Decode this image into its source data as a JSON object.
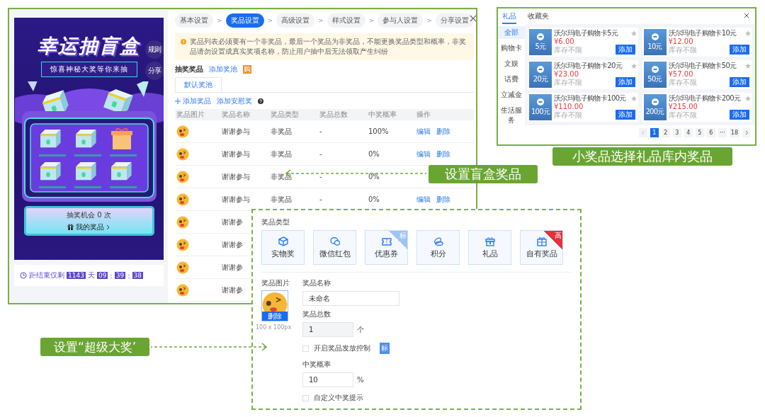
{
  "preview": {
    "title": "幸运抽盲盒",
    "rules_button": "规则",
    "share_button": "分享",
    "subtitle": "惊喜神秘大奖等你来抽",
    "chances": "抽奖机会 0 次",
    "my_prizes": "我的奖品",
    "countdown": [
      {
        "kind": "text",
        "text": "距结束仅剩"
      },
      {
        "kind": "box",
        "text": "1143"
      },
      {
        "kind": "text",
        "text": "天"
      },
      {
        "kind": "box",
        "text": "09"
      },
      {
        "kind": "text",
        "text": ":"
      },
      {
        "kind": "box",
        "text": "39"
      },
      {
        "kind": "text",
        "text": ":"
      },
      {
        "kind": "box",
        "text": "38"
      }
    ]
  },
  "steps": [
    {
      "label": "基本设置",
      "selected": false
    },
    {
      "label": "奖品设置",
      "selected": true
    },
    {
      "label": "高级设置",
      "selected": false
    },
    {
      "label": "样式设置",
      "selected": false
    },
    {
      "label": "参与人设置",
      "selected": false
    },
    {
      "label": "分享设置",
      "selected": false
    }
  ],
  "step_separator": ">",
  "notice": "奖品列表必须要有一个非奖品，最后一个奖品为非奖品，不能更换奖品类型和概率，非奖品请勿设置成真实奖项名称，防止用户抽中后无法领取产生纠纷",
  "pool_label": "抽奖奖品",
  "add_pool_link": "添加奖池",
  "pool_badge": "购",
  "pool_tabs": [
    {
      "label": "默认奖池",
      "selected": true
    }
  ],
  "add_prize_link": "添加奖品",
  "add_consolation_link": "添加安慰奖",
  "table": {
    "columns": [
      "奖品图片",
      "奖品名称",
      "奖品类型",
      "奖品总数",
      "中奖概率",
      "操作"
    ],
    "rows": [
      {
        "name": "谢谢参与",
        "type": "非奖品",
        "total": "-",
        "probability": "100%",
        "actions": [
          "编辑",
          "删除"
        ]
      },
      {
        "name": "谢谢参与",
        "type": "非奖品",
        "total": "-",
        "probability": "0%",
        "actions": [
          "编辑",
          "删除"
        ]
      },
      {
        "name": "谢谢参与",
        "type": "非奖品",
        "total": "-",
        "probability": "0%"
      },
      {
        "name": "谢谢参与",
        "type": "非奖品",
        "total": "-",
        "probability": "0%",
        "actions": [
          "编辑",
          "删除"
        ]
      },
      {
        "name": "谢谢参"
      },
      {
        "name": "谢谢参"
      },
      {
        "name": "谢谢参"
      },
      {
        "name": "谢谢参"
      }
    ]
  },
  "gift_panel": {
    "tabs": [
      {
        "label": "礼品",
        "selected": true
      },
      {
        "label": "收藏夹",
        "selected": false
      }
    ],
    "categories": [
      {
        "label": "全部",
        "selected": true
      },
      {
        "label": "购物卡",
        "selected": false
      },
      {
        "label": "文娱",
        "selected": false
      },
      {
        "label": "话费",
        "selected": false
      },
      {
        "label": "立减金",
        "selected": false
      },
      {
        "label": "生活服务",
        "selected": false
      }
    ],
    "items": [
      {
        "name": "沃尔玛电子购物卡5元",
        "card_value": "5元",
        "price": "¥6.00",
        "stock": "库存不限",
        "add": "添加"
      },
      {
        "name": "沃尔玛电子购物卡10元",
        "card_value": "10元",
        "price": "¥12.00",
        "stock": "库存不限",
        "add": "添加"
      },
      {
        "name": "沃尔玛电子购物卡20元",
        "card_value": "20元",
        "price": "¥23.00",
        "stock": "库存不限",
        "add": "添加"
      },
      {
        "name": "沃尔玛电子购物卡50元",
        "card_value": "50元",
        "price": "¥57.00",
        "stock": "库存不限",
        "add": "添加"
      },
      {
        "name": "沃尔玛电子购物卡100元",
        "card_value": "100元",
        "price": "¥110.00",
        "stock": "库存不限",
        "add": "添加"
      },
      {
        "name": "沃尔玛电子购物卡200元",
        "card_value": "200元",
        "price": "¥215.00",
        "stock": "库存不限",
        "add": "添加"
      }
    ],
    "pages": [
      {
        "label": "1",
        "selected": true
      },
      {
        "label": "2",
        "selected": false
      },
      {
        "label": "3",
        "selected": false
      },
      {
        "label": "4",
        "selected": false
      },
      {
        "label": "5",
        "selected": false
      },
      {
        "label": "6",
        "selected": false
      },
      {
        "label": "···",
        "selected": false
      },
      {
        "label": "18",
        "selected": false
      }
    ]
  },
  "prize_form": {
    "type_label": "奖品类型",
    "types": [
      {
        "label": "实物奖",
        "kind": "cube"
      },
      {
        "label": "微信红包",
        "kind": "chat"
      },
      {
        "label": "优惠券",
        "kind": "ticket",
        "badge": {
          "text": "标",
          "color": "#9fc4f3"
        }
      },
      {
        "label": "积分",
        "kind": "coins"
      },
      {
        "label": "礼品",
        "kind": "giftbox"
      },
      {
        "label": "自有奖品",
        "kind": "gift",
        "badge": {
          "text": "高",
          "color": "#e8303a"
        }
      }
    ],
    "image_label": "奖品图片",
    "delete_image": "删除",
    "image_hint": "100 x 100px",
    "name_label": "奖品名称",
    "name_value": "未命名",
    "total_label": "奖品总数",
    "total_value": "1",
    "total_unit": "个",
    "release_control": {
      "label": "开启奖品发放控制",
      "checked": false,
      "badge": "标"
    },
    "probability_label": "中奖概率",
    "probability_value": "10",
    "probability_unit": "%",
    "custom_tip": {
      "label": "自定义中奖提示",
      "checked": false
    }
  },
  "callouts": [
    {
      "text": "小奖品选择礼品库内奖品"
    },
    {
      "text": "设置盲盒奖品"
    },
    {
      "text": "设置“超级大奖’"
    }
  ]
}
